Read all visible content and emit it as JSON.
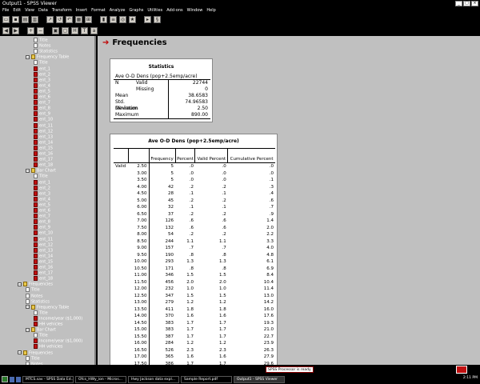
{
  "window": {
    "title": "Output1 - SPSS Viewer"
  },
  "menu": [
    "File",
    "Edit",
    "View",
    "Data",
    "Transform",
    "Insert",
    "Format",
    "Analyze",
    "Graphs",
    "Utilities",
    "Add-ons",
    "Window",
    "Help"
  ],
  "outline": [
    {
      "indent": 2,
      "icon": "doc",
      "label": "Title",
      "tog": ""
    },
    {
      "indent": 2,
      "icon": "doc",
      "label": "Notes",
      "tog": ""
    },
    {
      "indent": 2,
      "icon": "doc",
      "label": "Statistics",
      "tog": ""
    },
    {
      "indent": 1,
      "icon": "book",
      "label": "Frequency Table",
      "tog": "-"
    },
    {
      "indent": 2,
      "icon": "doc",
      "label": "Title",
      "tog": ""
    },
    {
      "indent": 2,
      "icon": "red",
      "label": "ent_1",
      "tog": ""
    },
    {
      "indent": 2,
      "icon": "red",
      "label": "ent_2",
      "tog": ""
    },
    {
      "indent": 2,
      "icon": "red",
      "label": "ent_3",
      "tog": ""
    },
    {
      "indent": 2,
      "icon": "red",
      "label": "ent_4",
      "tog": ""
    },
    {
      "indent": 2,
      "icon": "red",
      "label": "ent_5",
      "tog": ""
    },
    {
      "indent": 2,
      "icon": "red",
      "label": "ent_6",
      "tog": ""
    },
    {
      "indent": 2,
      "icon": "red",
      "label": "ent_7",
      "tog": ""
    },
    {
      "indent": 2,
      "icon": "red",
      "label": "ent_8",
      "tog": ""
    },
    {
      "indent": 2,
      "icon": "red",
      "label": "ent_9",
      "tog": ""
    },
    {
      "indent": 2,
      "icon": "red",
      "label": "ent_10",
      "tog": ""
    },
    {
      "indent": 2,
      "icon": "red",
      "label": "ent_11",
      "tog": ""
    },
    {
      "indent": 2,
      "icon": "red",
      "label": "ent_12",
      "tog": ""
    },
    {
      "indent": 2,
      "icon": "red",
      "label": "ent_13",
      "tog": ""
    },
    {
      "indent": 2,
      "icon": "red",
      "label": "ent_14",
      "tog": ""
    },
    {
      "indent": 2,
      "icon": "red",
      "label": "ent_15",
      "tog": ""
    },
    {
      "indent": 2,
      "icon": "red",
      "label": "ent_16",
      "tog": ""
    },
    {
      "indent": 2,
      "icon": "red",
      "label": "ent_17",
      "tog": ""
    },
    {
      "indent": 2,
      "icon": "red",
      "label": "ent_18",
      "tog": ""
    },
    {
      "indent": 1,
      "icon": "book",
      "label": "Bar Chart",
      "tog": "-"
    },
    {
      "indent": 2,
      "icon": "doc",
      "label": "Title",
      "tog": ""
    },
    {
      "indent": 2,
      "icon": "red",
      "label": "ent_1",
      "tog": ""
    },
    {
      "indent": 2,
      "icon": "red",
      "label": "ent_2",
      "tog": ""
    },
    {
      "indent": 2,
      "icon": "red",
      "label": "ent_3",
      "tog": ""
    },
    {
      "indent": 2,
      "icon": "red",
      "label": "ent_4",
      "tog": ""
    },
    {
      "indent": 2,
      "icon": "red",
      "label": "ent_5",
      "tog": ""
    },
    {
      "indent": 2,
      "icon": "red",
      "label": "ent_6",
      "tog": ""
    },
    {
      "indent": 2,
      "icon": "red",
      "label": "ent_7",
      "tog": ""
    },
    {
      "indent": 2,
      "icon": "red",
      "label": "ent_8",
      "tog": ""
    },
    {
      "indent": 2,
      "icon": "red",
      "label": "ent_9",
      "tog": ""
    },
    {
      "indent": 2,
      "icon": "red",
      "label": "ent_10",
      "tog": ""
    },
    {
      "indent": 2,
      "icon": "red",
      "label": "ent_11",
      "tog": ""
    },
    {
      "indent": 2,
      "icon": "red",
      "label": "ent_12",
      "tog": ""
    },
    {
      "indent": 2,
      "icon": "red",
      "label": "ent_13",
      "tog": ""
    },
    {
      "indent": 2,
      "icon": "red",
      "label": "ent_14",
      "tog": ""
    },
    {
      "indent": 2,
      "icon": "red",
      "label": "ent_15",
      "tog": ""
    },
    {
      "indent": 2,
      "icon": "red",
      "label": "ent_16",
      "tog": ""
    },
    {
      "indent": 2,
      "icon": "red",
      "label": "ent_17",
      "tog": ""
    },
    {
      "indent": 2,
      "icon": "red",
      "label": "ent_18",
      "tog": ""
    },
    {
      "indent": 0,
      "icon": "book",
      "label": "Frequencies",
      "tog": "-"
    },
    {
      "indent": 1,
      "icon": "doc",
      "label": "Title",
      "tog": ""
    },
    {
      "indent": 1,
      "icon": "doc",
      "label": "Notes",
      "tog": ""
    },
    {
      "indent": 1,
      "icon": "doc",
      "label": "Statistics",
      "tog": ""
    },
    {
      "indent": 1,
      "icon": "book",
      "label": "Frequency Table",
      "tog": "-"
    },
    {
      "indent": 2,
      "icon": "doc",
      "label": "Title",
      "tog": ""
    },
    {
      "indent": 2,
      "icon": "red",
      "label": "Income/year ($1,000)",
      "tog": ""
    },
    {
      "indent": 2,
      "icon": "red",
      "label": "HH vehicles",
      "tog": ""
    },
    {
      "indent": 1,
      "icon": "book",
      "label": "Bar Chart",
      "tog": "-"
    },
    {
      "indent": 2,
      "icon": "doc",
      "label": "Title",
      "tog": ""
    },
    {
      "indent": 2,
      "icon": "red",
      "label": "Income/year ($1,000)",
      "tog": ""
    },
    {
      "indent": 2,
      "icon": "red",
      "label": "HH vehicles",
      "tog": ""
    },
    {
      "indent": 0,
      "icon": "book",
      "label": "Frequencies",
      "tog": "-"
    },
    {
      "indent": 1,
      "icon": "doc",
      "label": "Title",
      "tog": ""
    },
    {
      "indent": 1,
      "icon": "doc",
      "label": "Notes",
      "tog": ""
    }
  ],
  "heading": "Frequencies",
  "stats": {
    "title": "Statistics",
    "subtitle": "Ave O-D Dens (pop+2.5emp/acre)",
    "rows": [
      {
        "a": "N",
        "b": "Valid",
        "v": "22744"
      },
      {
        "a": "",
        "b": "Missing",
        "v": "0"
      },
      {
        "a": "Mean",
        "b": "",
        "v": "38.6583"
      },
      {
        "a": "Std. Deviation",
        "b": "",
        "v": "74.96583"
      },
      {
        "a": "Minimum",
        "b": "",
        "v": "2.50"
      },
      {
        "a": "Maximum",
        "b": "",
        "v": "890.00"
      }
    ]
  },
  "freq": {
    "title": "Ave O-D Dens (pop+2.5emp/acre)",
    "headers": [
      "",
      "",
      "Frequency",
      "Percent",
      "Valid Percent",
      "Cumulative Percent"
    ],
    "valid_label": "Valid",
    "rows": [
      [
        "2.50",
        "5",
        ".0",
        ".0",
        ".0"
      ],
      [
        "3.00",
        "5",
        ".0",
        ".0",
        ".0"
      ],
      [
        "3.50",
        "5",
        ".0",
        ".0",
        ".1"
      ],
      [
        "4.00",
        "42",
        ".2",
        ".2",
        ".3"
      ],
      [
        "4.50",
        "28",
        ".1",
        ".1",
        ".4"
      ],
      [
        "5.00",
        "45",
        ".2",
        ".2",
        ".6"
      ],
      [
        "6.00",
        "32",
        ".1",
        ".1",
        ".7"
      ],
      [
        "6.50",
        "37",
        ".2",
        ".2",
        ".9"
      ],
      [
        "7.00",
        "126",
        ".6",
        ".6",
        "1.4"
      ],
      [
        "7.50",
        "132",
        ".6",
        ".6",
        "2.0"
      ],
      [
        "8.00",
        "54",
        ".2",
        ".2",
        "2.2"
      ],
      [
        "8.50",
        "244",
        "1.1",
        "1.1",
        "3.3"
      ],
      [
        "9.00",
        "157",
        ".7",
        ".7",
        "4.0"
      ],
      [
        "9.50",
        "190",
        ".8",
        ".8",
        "4.8"
      ],
      [
        "10.00",
        "293",
        "1.3",
        "1.3",
        "6.1"
      ],
      [
        "10.50",
        "171",
        ".8",
        ".8",
        "6.9"
      ],
      [
        "11.00",
        "346",
        "1.5",
        "1.5",
        "8.4"
      ],
      [
        "11.50",
        "456",
        "2.0",
        "2.0",
        "10.4"
      ],
      [
        "12.00",
        "232",
        "1.0",
        "1.0",
        "11.4"
      ],
      [
        "12.50",
        "347",
        "1.5",
        "1.5",
        "13.0"
      ],
      [
        "13.00",
        "279",
        "1.2",
        "1.2",
        "14.2"
      ],
      [
        "13.50",
        "411",
        "1.8",
        "1.8",
        "16.0"
      ],
      [
        "14.00",
        "370",
        "1.6",
        "1.6",
        "17.6"
      ],
      [
        "14.50",
        "383",
        "1.7",
        "1.7",
        "19.3"
      ],
      [
        "15.00",
        "383",
        "1.7",
        "1.7",
        "21.0"
      ],
      [
        "15.50",
        "387",
        "1.7",
        "1.7",
        "22.7"
      ],
      [
        "16.00",
        "284",
        "1.2",
        "1.2",
        "23.9"
      ],
      [
        "16.50",
        "526",
        "2.3",
        "2.3",
        "26.3"
      ],
      [
        "17.00",
        "365",
        "1.6",
        "1.6",
        "27.9"
      ],
      [
        "17.50",
        "386",
        "1.7",
        "1.7",
        "29.6"
      ]
    ]
  },
  "status": {
    "message": "SPSS Processor is ready"
  },
  "taskbar": {
    "tasks": [
      {
        "label": "MTCS.sav - SPSS Data Ed...",
        "active": false
      },
      {
        "label": "Ofcs_HWy_ion - Micros...",
        "active": false
      },
      {
        "label": "Hwy Jackson data expl...",
        "active": false
      },
      {
        "label": "Sample Report.pdf",
        "active": false
      },
      {
        "label": "Output1 - SPSS Viewer",
        "active": true
      }
    ],
    "clock": "2:11 PM"
  }
}
